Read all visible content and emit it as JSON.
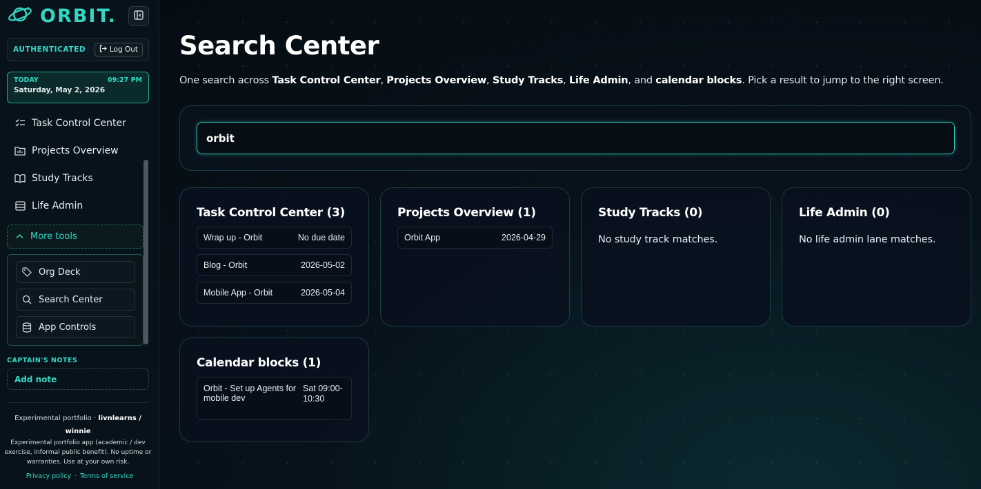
{
  "brand": {
    "name": "ORBIT."
  },
  "auth": {
    "status": "AUTHENTICATED",
    "logout_label": "Log Out"
  },
  "today": {
    "label": "TODAY",
    "time": "09:27 PM",
    "date": "Saturday, May 2, 2026"
  },
  "nav": [
    {
      "label": "Task Control Center",
      "icon": "checklist-icon"
    },
    {
      "label": "Projects Overview",
      "icon": "folder-chart-icon"
    },
    {
      "label": "Study Tracks",
      "icon": "book-icon"
    },
    {
      "label": "Life Admin",
      "icon": "list-icon"
    }
  ],
  "more_tools": {
    "label": "More tools",
    "items": [
      {
        "label": "Org Deck",
        "icon": "tag-icon"
      },
      {
        "label": "Search Center",
        "icon": "search-icon"
      },
      {
        "label": "App Controls",
        "icon": "database-icon"
      }
    ]
  },
  "captains_notes": {
    "label": "CAPTAIN'S NOTES",
    "add_label": "Add note"
  },
  "footer": {
    "title_prefix": "Experimental portfolio · ",
    "title_bold": "livnlearns / winnie",
    "disclaimer": "Experimental portfolio app (academic / dev exercise, informal public benefit). No uptime or warranties. Use at your own risk.",
    "privacy": "Privacy policy",
    "separator": "·",
    "terms": "Terms of service"
  },
  "page": {
    "title": "Search Center",
    "desc_parts": [
      "One search across ",
      "Task Control Center",
      ", ",
      "Projects Overview",
      ", ",
      "Study Tracks",
      ", ",
      "Life Admin",
      ", and ",
      "calendar blocks",
      ". Pick a result to jump to the right screen."
    ]
  },
  "search": {
    "value": "orbit"
  },
  "results": {
    "tasks": {
      "title": "Task Control Center (3)",
      "rows": [
        {
          "name": "Wrap up - Orbit",
          "date": "No due date"
        },
        {
          "name": "Blog - Orbit",
          "date": "2026-05-02"
        },
        {
          "name": "Mobile App - Orbit",
          "date": "2026-05-04"
        }
      ]
    },
    "projects": {
      "title": "Projects Overview (1)",
      "rows": [
        {
          "name": "Orbit App",
          "date": "2026-04-29"
        }
      ]
    },
    "study": {
      "title": "Study Tracks (0)",
      "empty": "No study track matches."
    },
    "life": {
      "title": "Life Admin (0)",
      "empty": "No life admin lane matches."
    },
    "calendar": {
      "title": "Calendar blocks (1)",
      "rows": [
        {
          "name": "Orbit - Set up Agents for mobile dev",
          "time": "Sat 09:00-10:30"
        }
      ]
    }
  },
  "colors": {
    "accent": "#33d6c3",
    "background": "#060b12",
    "card_border": "#1d3a42"
  }
}
